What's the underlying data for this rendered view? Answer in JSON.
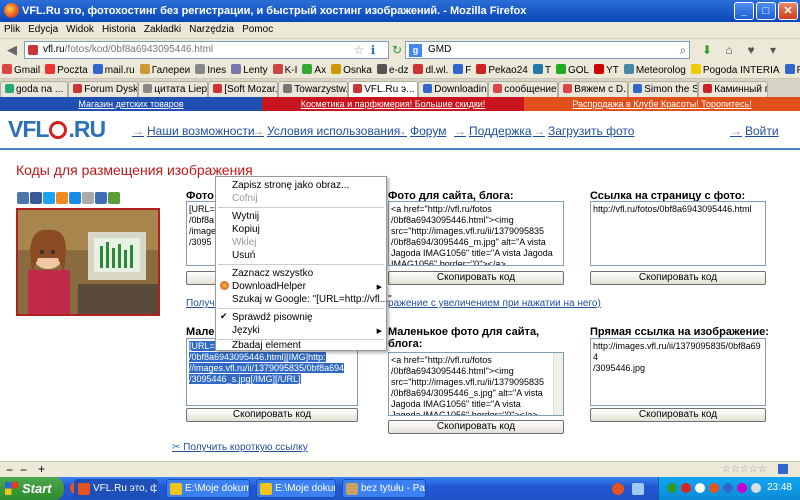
{
  "window": {
    "title": "VFL.Ru это, фотохостинг без регистрации, и быстрый хостинг изображений. - Mozilla Firefox"
  },
  "menu": [
    "Plik",
    "Edycja",
    "Widok",
    "Historia",
    "Zakładki",
    "Narzędzia",
    "Pomoc"
  ],
  "navbar": {
    "url_host": "vfl.ru",
    "url_path": "/fotos/kod/0bf8a6943095446.html",
    "search_value": "GMD"
  },
  "bookmarks": [
    "Gmail",
    "Poczta",
    "mail.ru",
    "Галереи",
    "Ines",
    "Lenty",
    "K-I",
    "Ax",
    "Osnka",
    "e-dz",
    "dl.wl.",
    "F",
    "Pekao24",
    "T",
    "GOL",
    "YT",
    "Meteorolog",
    "Pogoda INTERIA",
    "Picasa moja"
  ],
  "tabs": [
    "goda na ...",
    "Forum Dysk...",
    "цитата Liep...",
    "[Soft Mozar...",
    "Towarzystw...",
    "VFL.Ru э...",
    "Downloading...",
    "сообщение...",
    "Вяжем с D...",
    "Simon the S...",
    "Каминный г..."
  ],
  "promo": [
    "Магазин детских товаров",
    "Косметика и парфюмерия! Большие скидки!",
    "Распродажа в Клубе Красоты! Торопитесь!"
  ],
  "site": {
    "logo": "VFLORU",
    "nav": [
      "Наши возможности",
      "Условия использования",
      "Форум",
      "Поддержка",
      "Загрузить фото",
      "Войти"
    ],
    "page_title": "Коды для размещения изображения"
  },
  "blocks": {
    "b1_title": "Фото д...",
    "b1_code": "[URL=http\n/0bf8a\n/image\n/3095",
    "b2_title": "Фото для сайта, блога:",
    "b2_code": "<a href=\"http://vfl.ru/fotos\n/0bf8a6943095446.html\"><img\nsrc=\"http://images.vfl.ru/ii/1379095835\n/0bf8a694/3095446_m.jpg\" alt=\"A vista\nJagoda IMAG1056\" title=\"A vista Jagoda\nIMAG1056\" border=\"0\"></a>",
    "b3_title": "Ссылка на страницу с фото:",
    "b3_code": "http://vfl.ru/fotos/0bf8a6943095446.html",
    "link1": "Получит",
    "link1b": "ражение с увеличением при нажатии на него)",
    "b4_title": "Мален",
    "b4_code": "[URL=h\n/0bf8a6943095446.html][IMG]http:\n//images.vfl.ru/ii/1379095835/0bf8a694\n/3095446_s.jpg[/IMG][/URL]",
    "b5_title": "Маленькое фото для сайта,\nблога:",
    "b5_code": "<a href=\"http://vfl.ru/fotos\n/0bf8a6943095446.html\"><img\nsrc=\"http://images.vfl.ru/ii/1379095835\n/0bf8a694/3095446_s.jpg\" alt=\"A vista\nJagoda IMAG1056\" title=\"A vista\nJagoda IMAG1056\" border=\"0\"></a>",
    "b6_title": "Прямая ссылка на изображение:",
    "b6_code": "http://images.vfl.ru/ii/1379095835/0bf8a694\n/3095446.jpg",
    "copy_label": "Скопировать код",
    "short_link": "Получить короткую ссылку"
  },
  "context_menu": {
    "items": [
      "Zapisz stronę jako obraz...",
      "Cofnij",
      "Wytnij",
      "Kopiuj",
      "Wklej",
      "Usuń",
      "Zaznacz wszystko",
      "DownloadHelper",
      "Szukaj w Google: \"[URL=http://vfl...\"",
      "Sprawdź pisownię",
      "Języki",
      "Zbadaj element"
    ]
  },
  "taskbar": {
    "start": "Start",
    "tasks": [
      "VFL.Ru это, ф...",
      "E:\\Moje dokum...",
      "E:\\Moje dokum...",
      "bez tytułu - Paint"
    ],
    "clock": "23:48"
  },
  "colors": {
    "accent": "#2a71b8",
    "title": "#c01818",
    "link": "#1f4f9a",
    "promo1": "#1f4fb0",
    "promo2": "#c8141c",
    "promo3": "#e0501a"
  }
}
